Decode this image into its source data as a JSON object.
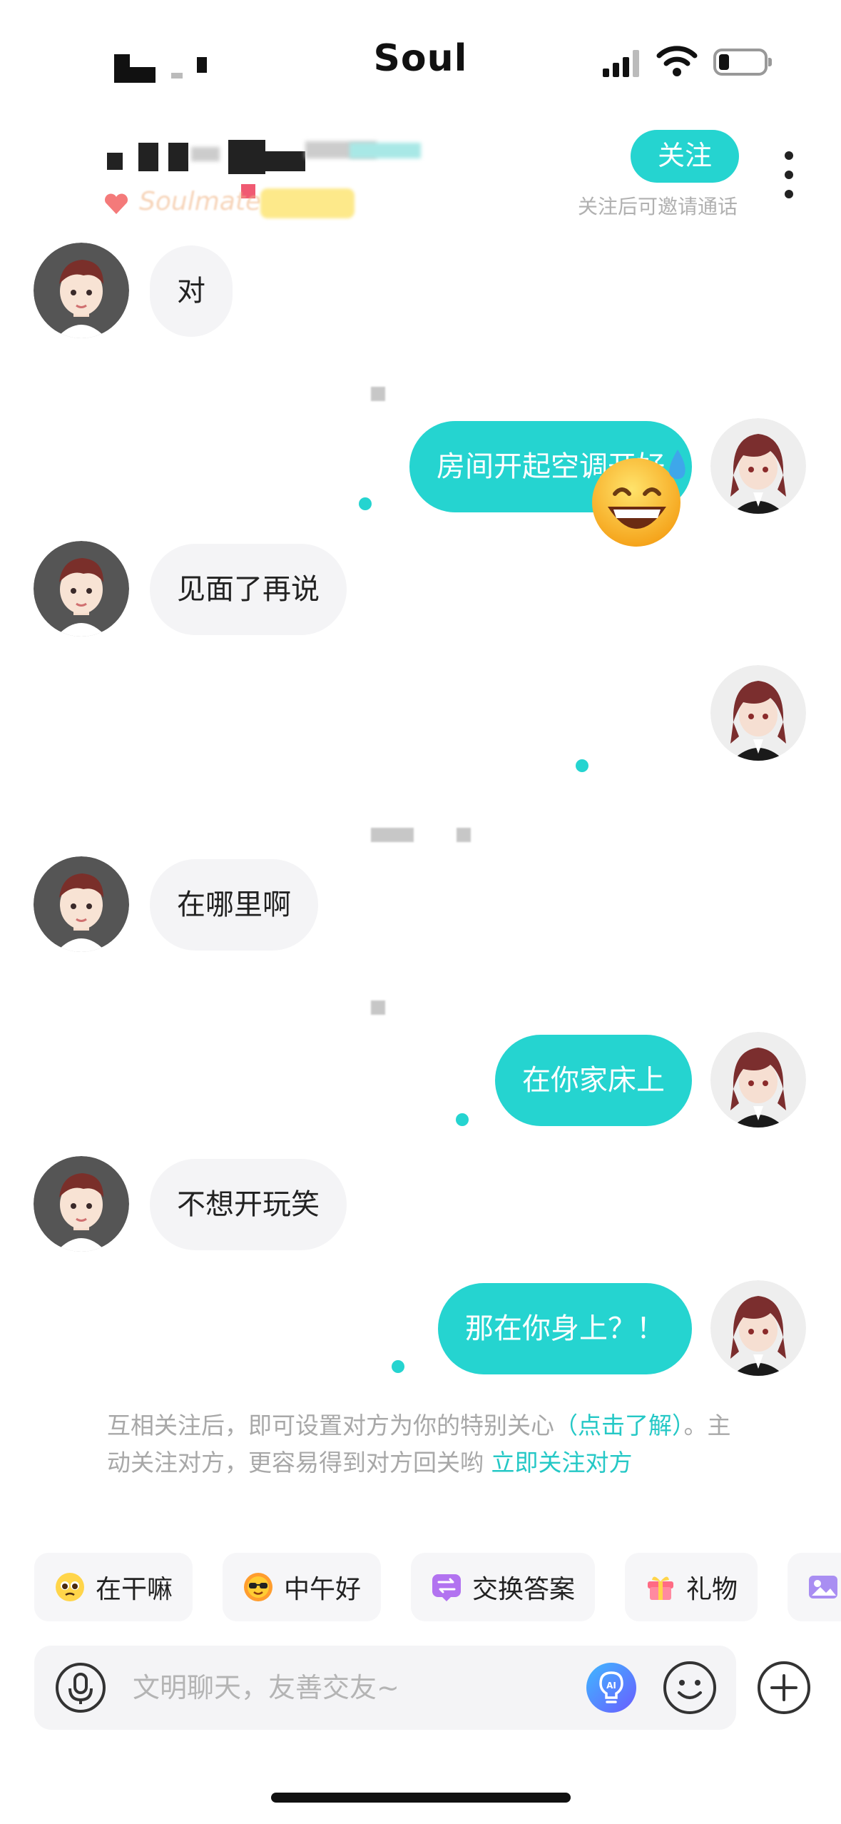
{
  "status_bar": {
    "app_label": "Soul"
  },
  "header": {
    "follow_button": "关注",
    "follow_hint": "关注后可邀请通话",
    "soulmate_tag": "Soulmate"
  },
  "messages": [
    {
      "side": "in",
      "text": "对"
    },
    {
      "side": "out",
      "text": "房间开起空调开好"
    },
    {
      "side": "in",
      "text": "见面了再说"
    },
    {
      "side": "out",
      "type": "sticker",
      "sticker": "grinning-sweat-emoji"
    },
    {
      "side": "in",
      "text": "在哪里啊"
    },
    {
      "side": "out",
      "text": "在你家床上"
    },
    {
      "side": "in",
      "text": "不想开玩笑"
    },
    {
      "side": "out",
      "text": "那在你身上？！"
    }
  ],
  "notice": {
    "text_1": "互相关注后，即可设置对方为你的特别关心",
    "link_1": "（点击了解）",
    "text_2": "。主动关注对方，更容易得到对方回关哟 ",
    "link_2": "立即关注对方"
  },
  "quick_actions": [
    {
      "label": "在干嘛",
      "icon": "pleading-face-icon"
    },
    {
      "label": "中午好",
      "icon": "sun-sunglasses-icon"
    },
    {
      "label": "交换答案",
      "icon": "exchange-icon"
    },
    {
      "label": "礼物",
      "icon": "gift-icon"
    },
    {
      "label": "",
      "icon": "photo-icon"
    }
  ],
  "composer": {
    "placeholder": "文明聊天，友善交友~"
  },
  "colors": {
    "accent": "#25d4d0",
    "incoming_bubble": "#f4f4f6",
    "link": "#25c8c6"
  }
}
